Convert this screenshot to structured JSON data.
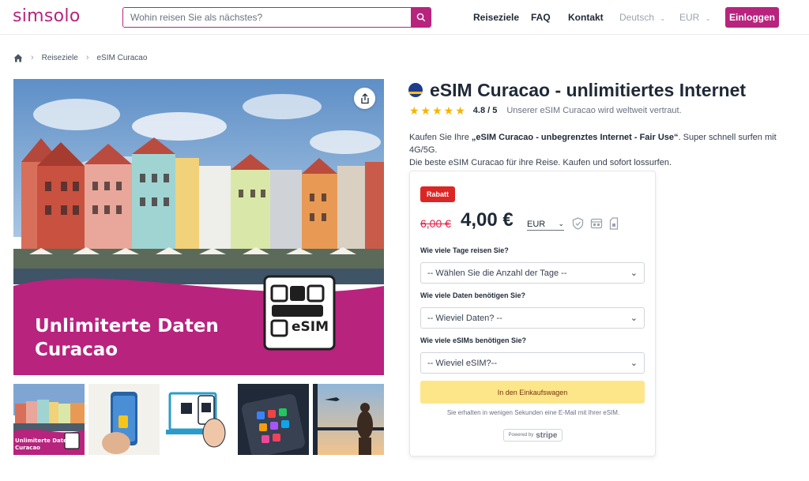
{
  "header": {
    "logo": "simsolo",
    "search_placeholder": "Wohin reisen Sie als nächstes?",
    "nav": [
      "Reiseziele",
      "FAQ",
      "Kontakt"
    ],
    "language": "Deutsch",
    "currency": "EUR",
    "login": "Einloggen"
  },
  "breadcrumb": {
    "home_icon": "home-icon",
    "items": [
      "Reiseziele",
      "eSIM Curacao"
    ]
  },
  "gallery": {
    "banner_line1": "Unlimiterte Daten",
    "banner_line2": "Curacao",
    "esim_label": "eSIM",
    "thumb_label1": "Unlimiterte Daten",
    "thumb_label2": "Curacao",
    "thumb_count": 5
  },
  "product": {
    "title": "eSIM Curacao - unlimitiertes Internet",
    "stars": "★★★★★",
    "rating": "4.8 / 5",
    "trust_text": "Unserer eSIM Curacao wird weltweit vertraut.",
    "desc_prefix": "Kaufen Sie Ihre ",
    "desc_bold": "„eSIM Curacao - unbegrenztes Internet - Fair Use“",
    "desc_suffix": ". Super schnell surfen mit 4G/5G.",
    "desc_line2": "Die beste eSIM Curacao für ihre Reise. Kaufen und sofort lossurfen."
  },
  "purchase": {
    "badge": "Rabatt",
    "old_price": "6,00 €",
    "new_price": "4,00 €",
    "currency": "EUR",
    "q_days": "Wie viele Tage reisen Sie?",
    "select_days": "-- Wählen Sie die Anzahl der Tage --",
    "q_data": "Wie viele Daten benötigen Sie?",
    "select_data": "-- Wieviel Daten? --",
    "q_esims": "Wie viele eSIMs benötigen Sie?",
    "select_esims": "-- Wieviel eSIM?--",
    "cart_button": "In den Einkaufswagen",
    "note": "Sie erhalten in wenigen Sekunden eine E-Mail mit Ihrer eSIM.",
    "powered_by": "Powered by",
    "stripe": "stripe"
  },
  "colors": {
    "brand": "#b8237e",
    "badge": "#dc2626",
    "old_price": "#e11d48",
    "stars": "#f5b400",
    "cart": "#fde68a"
  }
}
